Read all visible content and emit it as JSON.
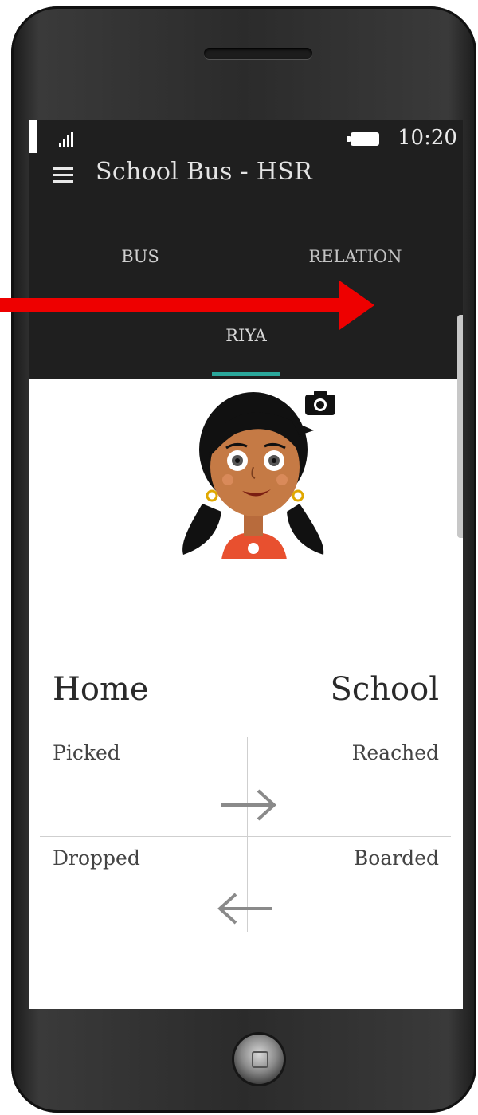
{
  "status": {
    "time": "10:20"
  },
  "app": {
    "title": "School Bus - HSR"
  },
  "tabs": [
    {
      "label": "BUS"
    },
    {
      "label": "RELATION"
    },
    {
      "label": "RIYA",
      "selected": true
    }
  ],
  "route": {
    "from": "Home",
    "to": "School",
    "outbound": {
      "left": "Picked",
      "right": "Reached"
    },
    "inbound": {
      "left": "Dropped",
      "right": "Boarded"
    }
  },
  "icons": [
    "menu-icon",
    "signal-icon",
    "battery-icon",
    "camera-icon",
    "arrow-right-icon",
    "arrow-left-icon"
  ],
  "colors": {
    "appbar": "#1f1f1f",
    "tab_indicator": "#2aa79b",
    "overlay_arrow": "#ee0000"
  }
}
